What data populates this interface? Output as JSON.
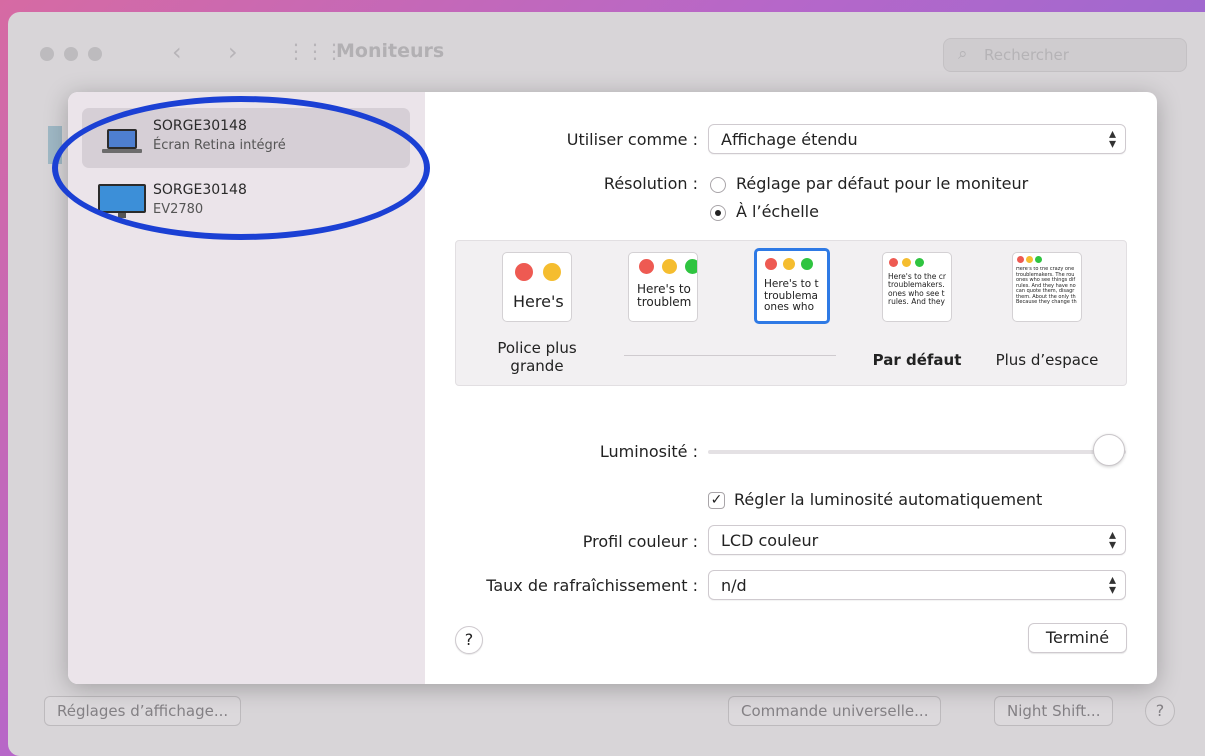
{
  "window": {
    "title": "Moniteurs",
    "search_placeholder": "Rechercher"
  },
  "displays": [
    {
      "name": "SORGE30148",
      "subtitle": "Écran Retina intégré",
      "selected": true
    },
    {
      "name": "SORGE30148",
      "subtitle": "EV2780",
      "selected": false
    }
  ],
  "settings": {
    "use_as_label": "Utiliser comme :",
    "use_as_value": "Affichage étendu",
    "resolution_label": "Résolution :",
    "resolution_options": [
      "Réglage par défaut pour le moniteur",
      "À l’échelle"
    ],
    "resolution_selected": 1,
    "scale_labels": [
      "Police plus grande",
      "",
      "",
      "Par défaut",
      "Plus d’espace"
    ],
    "thumb_texts": [
      "Here's",
      "Here's to\ntroublem",
      "Here's to t\ntroublema\nones who",
      "Here's to the cr\ntroublemakers.\nones who see t\nrules. And they",
      "Here's to the crazy one\ntroublemakers. The rou\nones who see things dif\nrules. And they have no\ncan quote them, disagr\nthem. About the only th\nBecause they change th"
    ],
    "brightness_label": "Luminosité :",
    "brightness_fraction": 0.96,
    "auto_brightness_label": "Régler la luminosité automatiquement",
    "auto_brightness_checked": true,
    "color_profile_label": "Profil couleur :",
    "color_profile_value": "LCD couleur",
    "refresh_label": "Taux de rafraîchissement :",
    "refresh_value": "n/d",
    "help_label": "?",
    "done_label": "Terminé"
  },
  "bottom_bar": {
    "display_settings": "Réglages d’affichage...",
    "universal_control": "Commande universelle...",
    "night_shift": "Night Shift...",
    "help": "?"
  },
  "colors": {
    "accent": "#2f7ae5",
    "annotation": "#1b40d4",
    "red": "#ee5a52",
    "yellow": "#f5bd2f",
    "green": "#2fc440"
  }
}
